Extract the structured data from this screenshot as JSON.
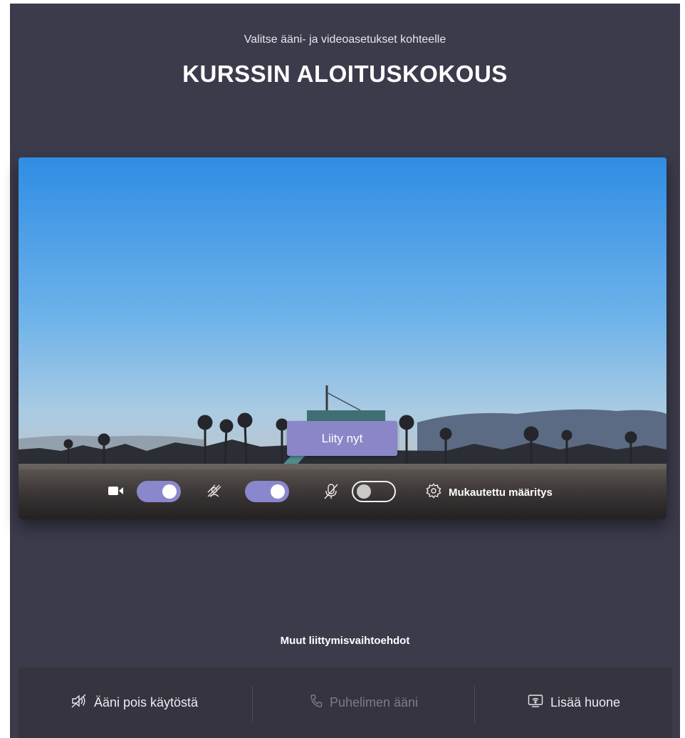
{
  "header": {
    "subtitle": "Valitse ääni- ja videoasetukset kohteelle",
    "title": "KURSSIN ALOITUSKOKOUS"
  },
  "preview": {
    "join_label": "Liity nyt",
    "camera": {
      "icon": "video-camera-icon",
      "enabled": true
    },
    "background_blur": {
      "icon": "background-blur-icon",
      "enabled": true
    },
    "microphone": {
      "icon": "microphone-off-icon",
      "enabled": false
    },
    "device_settings_label": "Mukautettu määritys"
  },
  "other_options": {
    "heading": "Muut liittymisvaihtoehdot",
    "items": [
      {
        "label": "Ääni pois käytöstä",
        "icon": "speaker-off-icon",
        "disabled": false
      },
      {
        "label": "Puhelimen ääni",
        "icon": "phone-icon",
        "disabled": true
      },
      {
        "label": "Lisää huone",
        "icon": "room-cast-icon",
        "disabled": false
      }
    ]
  },
  "colors": {
    "background": "#3c3b4c",
    "accent": "#8b87cc",
    "bottom_bar": "#35343f"
  }
}
